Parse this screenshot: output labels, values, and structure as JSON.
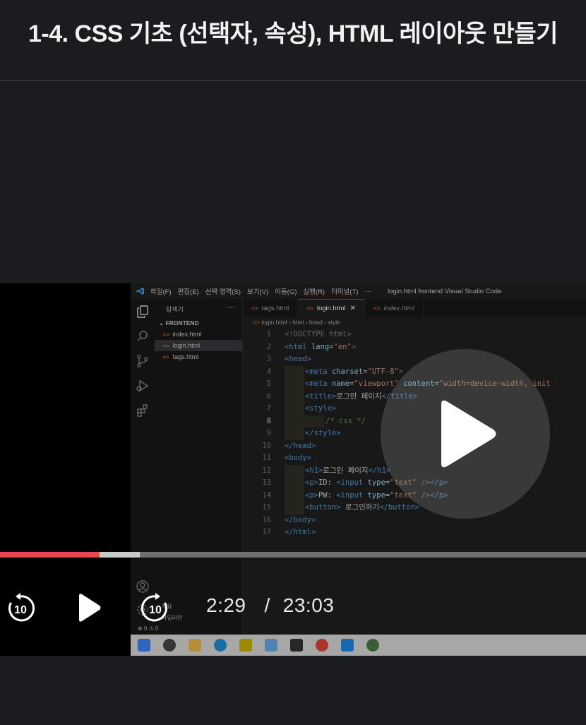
{
  "lecture": {
    "title": "1-4. CSS 기초 (선택자, 속성), HTML 레이아웃 만들기"
  },
  "vscode": {
    "menu": [
      "파일(F)",
      "편집(E)",
      "선택 영역(S)",
      "보기(V)",
      "이동(G)",
      "실행(R)",
      "터미널(T)",
      "···"
    ],
    "window_title": "login.html  frontend  Visual Studio Code",
    "explorer": {
      "header": "탐색기",
      "more": "···",
      "folder": "FRONTEND",
      "files": [
        {
          "name": "index.html"
        },
        {
          "name": "login.html"
        },
        {
          "name": "tags.html"
        }
      ],
      "bottom1": "개요",
      "bottom2": "타임라인",
      "status": "⊗ 0 ⚠ 0"
    },
    "tabs": [
      {
        "name": "tags.html"
      },
      {
        "name": "login.html"
      },
      {
        "name": "index.html"
      }
    ],
    "breadcrumbs": [
      "login.html",
      "html",
      "head",
      "style"
    ],
    "code_lines": [
      {
        "n": "1"
      },
      {
        "n": "2"
      },
      {
        "n": "3"
      },
      {
        "n": "4"
      },
      {
        "n": "5"
      },
      {
        "n": "6"
      },
      {
        "n": "7"
      },
      {
        "n": "8"
      },
      {
        "n": "9"
      },
      {
        "n": "10"
      },
      {
        "n": "11"
      },
      {
        "n": "12"
      },
      {
        "n": "13"
      },
      {
        "n": "14"
      },
      {
        "n": "15"
      },
      {
        "n": "16"
      },
      {
        "n": "17"
      }
    ],
    "code_text": {
      "l1": "<!DOCTYPE html>",
      "l2a": "<html ",
      "l2b": "lang",
      "l2c": "=",
      "l2d": "\"en\"",
      "l2e": ">",
      "l3": "<head>",
      "l4a": "<meta ",
      "l4b": "charset",
      "l4c": "=",
      "l4d": "\"UTF-8\"",
      "l4e": ">",
      "l5a": "<meta ",
      "l5b": "name",
      "l5c": "=",
      "l5d": "\"viewport\"",
      "l5e": " content",
      "l5f": "=",
      "l5g": "\"width=device-width, init",
      "l6a": "<title>",
      "l6b": "로그인 페이지",
      "l6c": "</title>",
      "l7": "<style>",
      "l8": "/* css */",
      "l9": "</style>",
      "l10": "</head>",
      "l11": "<body>",
      "l12a": "<h1>",
      "l12b": "로그인 페이지",
      "l12c": "</h1>",
      "l13a": "<p>",
      "l13b": "ID: ",
      "l13c": "<input ",
      "l13d": "type",
      "l13e": "=",
      "l13f": "\"text\"",
      "l13g": " />",
      "l13h": "</p>",
      "l14a": "<p>",
      "l14b": "PW: ",
      "l14c": "<input ",
      "l14d": "type",
      "l14e": "=",
      "l14f": "\"text\"",
      "l14g": " />",
      "l14h": "</p>",
      "l15a": "<button>",
      "l15b": " 로그인하기",
      "l15c": "</button>",
      "l16": "</body>",
      "l17": "</html>"
    }
  },
  "player": {
    "current_time": "2:29",
    "separator": "/",
    "duration": "23:03",
    "progress_fraction": 0.17,
    "rewind_label": "10",
    "forward_label": "10",
    "accent_color": "#e5484d"
  },
  "icons": [
    "vscode-logo-icon",
    "explorer-icon",
    "search-icon",
    "source-control-icon",
    "run-debug-icon",
    "extensions-icon",
    "account-icon",
    "settings-icon",
    "play-icon",
    "rewind-10-icon",
    "forward-10-icon",
    "big-play-icon"
  ]
}
